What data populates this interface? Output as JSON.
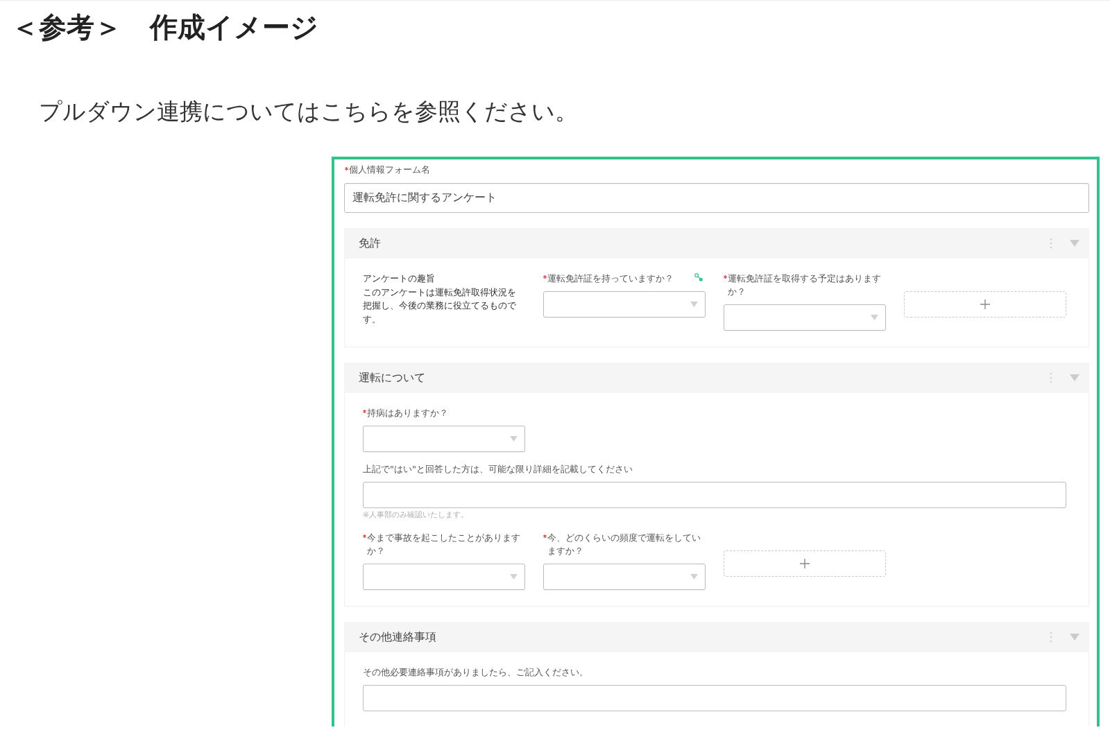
{
  "heading": "＜参考＞　作成イメージ",
  "note": "プルダウン連携についてはこちらを参照ください。",
  "form": {
    "name_field": {
      "label": "個人情報フォーム名",
      "required": true,
      "value": "運転免許に関するアンケート"
    },
    "sections": [
      {
        "title": "免許",
        "expanded": true,
        "rows": [
          {
            "items": [
              {
                "kind": "text",
                "title": "アンケートの趣旨",
                "body": "このアンケートは運転免許取得状況を把握し、今後の業務に役立てるものです。"
              },
              {
                "kind": "select",
                "label": "運転免許証を持っていますか？",
                "required": true,
                "linked": true
              },
              {
                "kind": "select",
                "label": "運転免許証を取得する予定はありますか？",
                "required": true,
                "linked": false
              },
              {
                "kind": "add"
              }
            ]
          }
        ]
      },
      {
        "title": "運転について",
        "expanded": true,
        "rows": [
          {
            "items": [
              {
                "kind": "select",
                "label": "持病はありますか？",
                "required": true,
                "linked": false
              }
            ]
          },
          {
            "items": [
              {
                "kind": "textbox",
                "label": "上記で\"はい\"と回答した方は、可能な限り詳細を記載してください",
                "required": false,
                "hint": "※人事部のみ確認いたします。"
              }
            ]
          },
          {
            "items": [
              {
                "kind": "select",
                "label": "今まで事故を起こしたことがありますか？",
                "required": true,
                "linked": false
              },
              {
                "kind": "select",
                "label": "今、どのくらいの頻度で運転をしていますか？",
                "required": true,
                "linked": false
              },
              {
                "kind": "add"
              }
            ]
          }
        ]
      },
      {
        "title": "その他連絡事項",
        "expanded": true,
        "rows": [
          {
            "items": [
              {
                "kind": "textbox",
                "label": "その他必要連絡事項がありましたら、ご記入ください。",
                "required": false
              }
            ]
          }
        ]
      }
    ]
  }
}
